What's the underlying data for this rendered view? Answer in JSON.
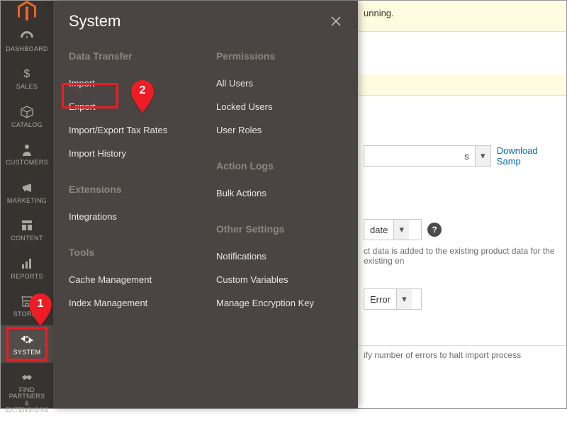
{
  "sidebar": {
    "items": [
      {
        "label": "DASHBOARD"
      },
      {
        "label": "SALES"
      },
      {
        "label": "CATALOG"
      },
      {
        "label": "CUSTOMERS"
      },
      {
        "label": "MARKETING"
      },
      {
        "label": "CONTENT"
      },
      {
        "label": "REPORTS"
      },
      {
        "label": "STORES"
      },
      {
        "label": "SYSTEM"
      },
      {
        "label": "FIND PARTNERS\n& EXTENSIONS"
      }
    ]
  },
  "flyout": {
    "title": "System",
    "groups_left": [
      {
        "title": "Data Transfer",
        "items": [
          "Import",
          "Export",
          "Import/Export Tax Rates",
          "Import History"
        ]
      },
      {
        "title": "Extensions",
        "items": [
          "Integrations"
        ]
      },
      {
        "title": "Tools",
        "items": [
          "Cache Management",
          "Index Management"
        ]
      }
    ],
    "groups_right": [
      {
        "title": "Permissions",
        "items": [
          "All Users",
          "Locked Users",
          "User Roles"
        ]
      },
      {
        "title": "Action Logs",
        "items": [
          "Bulk Actions"
        ]
      },
      {
        "title": "Other Settings",
        "items": [
          "Notifications",
          "Custom Variables",
          "Manage Encryption Key"
        ]
      }
    ]
  },
  "page": {
    "banner_top_fragment": "unning.",
    "entity_select_fragment": "s",
    "download_sample": "Download Samp",
    "behavior_select": "date",
    "behavior_tip": "ct data is added to the existing product data for the existing en",
    "error_select": "Error",
    "footer_fragment": "ify number of errors to halt import process"
  },
  "annotations": {
    "marker1": "1",
    "marker2": "2"
  }
}
